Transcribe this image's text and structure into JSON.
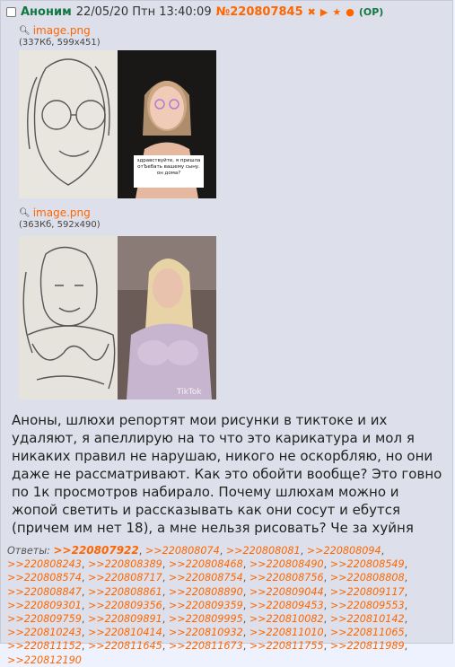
{
  "post": {
    "author": "Аноним",
    "datetime": "22/05/20 Птн 13:40:09",
    "number": "№220807845",
    "icons": [
      "close-icon",
      "play-icon",
      "star-icon",
      "dot-icon"
    ],
    "icon_glyphs": [
      "✖",
      "▶",
      "★",
      "●"
    ],
    "op_label": "(OP)",
    "files": [
      {
        "name": "image.png",
        "meta": "(337Кб, 599x451)",
        "caption": "здравствуйте, я пришла отЪебать вашему сыну. он дома?"
      },
      {
        "name": "image.png",
        "meta": "(363Кб, 592x490)",
        "watermark": "TikTok"
      }
    ],
    "text": "Аноны, шлюхи репортят мои рисунки в тиктоке и их удаляют, я апеллирую на то что это карикатура и мол я никаких правил не нарушаю, никого не оскорбляю, но они даже не рассматривают. Как это обойти вообще? Это говно по 1к просмотров набирало. Почему шлюхам можно и жопой светить и рассказывать как они сосут и ебутся (причем им нет 18), а мне нельзя рисовать? Че за хуйня",
    "replies_label": "Ответы:",
    "replies": [
      ">>220807922",
      ">>220808074",
      ">>220808081",
      ">>220808094",
      ">>220808243",
      ">>220808389",
      ">>220808468",
      ">>220808490",
      ">>220808549",
      ">>220808574",
      ">>220808717",
      ">>220808754",
      ">>220808756",
      ">>220808808",
      ">>220808847",
      ">>220808861",
      ">>220808890",
      ">>220809044",
      ">>220809117",
      ">>220809301",
      ">>220809356",
      ">>220809359",
      ">>220809453",
      ">>220809553",
      ">>220809759",
      ">>220809891",
      ">>220809995",
      ">>220810082",
      ">>220810142",
      ">>220810243",
      ">>220810414",
      ">>220810932",
      ">>220811010",
      ">>220811065",
      ">>220811152",
      ">>220811645",
      ">>220811673",
      ">>220811755",
      ">>220811989",
      ">>220812190"
    ]
  }
}
